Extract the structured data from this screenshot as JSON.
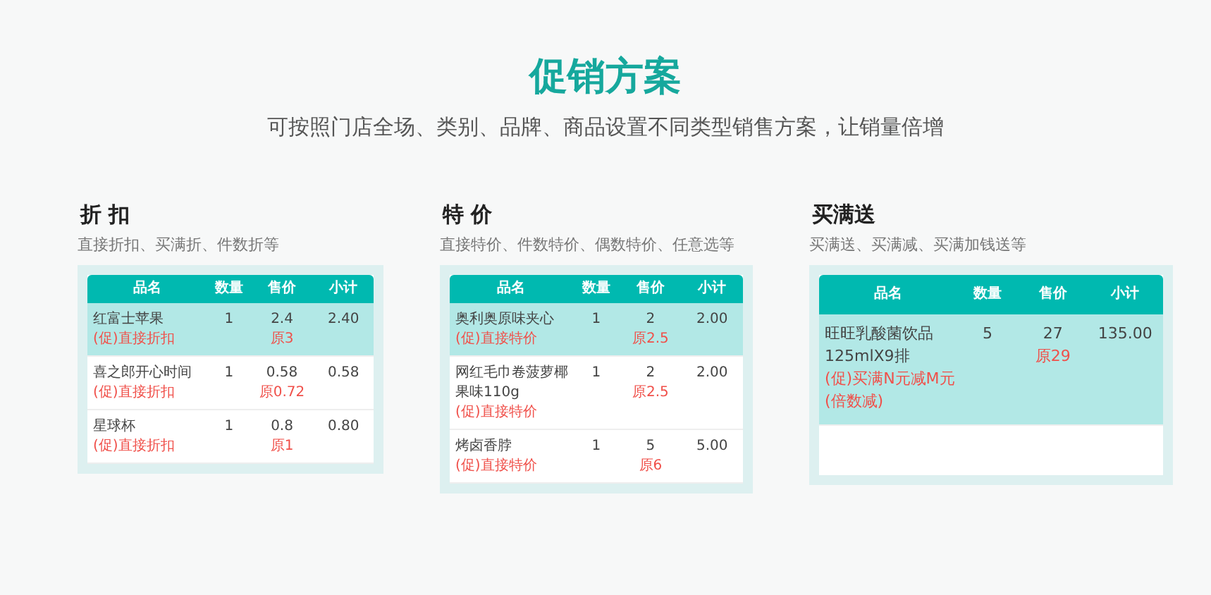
{
  "title": "促销方案",
  "subtitle": "可按照门店全场、类别、品牌、商品设置不同类型销售方案，让销量倍增",
  "sections": [
    {
      "heading": "折 扣",
      "description": "直接折扣、买满折、件数折等",
      "columns": [
        "品名",
        "数量",
        "售价",
        "小计"
      ],
      "rows": [
        {
          "name": "红富士苹果",
          "qty": "1",
          "price": "2.4",
          "subtotal": "2.40",
          "promo": "(促)直接折扣",
          "original": "原3",
          "selected": true
        },
        {
          "name": "喜之郎开心时间",
          "qty": "1",
          "price": "0.58",
          "subtotal": "0.58",
          "promo": "(促)直接折扣",
          "original": "原0.72",
          "selected": false
        },
        {
          "name": "星球杯",
          "qty": "1",
          "price": "0.8",
          "subtotal": "0.80",
          "promo": "(促)直接折扣",
          "original": "原1",
          "selected": false
        }
      ]
    },
    {
      "heading": "特 价",
      "description": "直接特价、件数特价、偶数特价、任意选等",
      "columns": [
        "品名",
        "数量",
        "售价",
        "小计"
      ],
      "rows": [
        {
          "name": "奥利奥原味夹心",
          "qty": "1",
          "price": "2",
          "subtotal": "2.00",
          "promo": "(促)直接特价",
          "original": "原2.5",
          "selected": true
        },
        {
          "name": "网红毛巾卷菠萝椰果味110g",
          "qty": "1",
          "price": "2",
          "subtotal": "2.00",
          "promo": "(促)直接特价",
          "original": "原2.5",
          "selected": false
        },
        {
          "name": "烤卤香脖",
          "qty": "1",
          "price": "5",
          "subtotal": "5.00",
          "promo": "(促)直接特价",
          "original": "原6",
          "selected": false
        }
      ]
    },
    {
      "heading": "买满送",
      "description": "买满送、买满减、买满加钱送等",
      "columns": [
        "品名",
        "数量",
        "售价",
        "小计"
      ],
      "rows": [
        {
          "name": "旺旺乳酸菌饮品125mlX9排",
          "qty": "5",
          "price": "27",
          "subtotal": "135.00",
          "promo": "(促)买满N元减M元(倍数减)",
          "original": "原29",
          "selected": true
        }
      ]
    }
  ]
}
